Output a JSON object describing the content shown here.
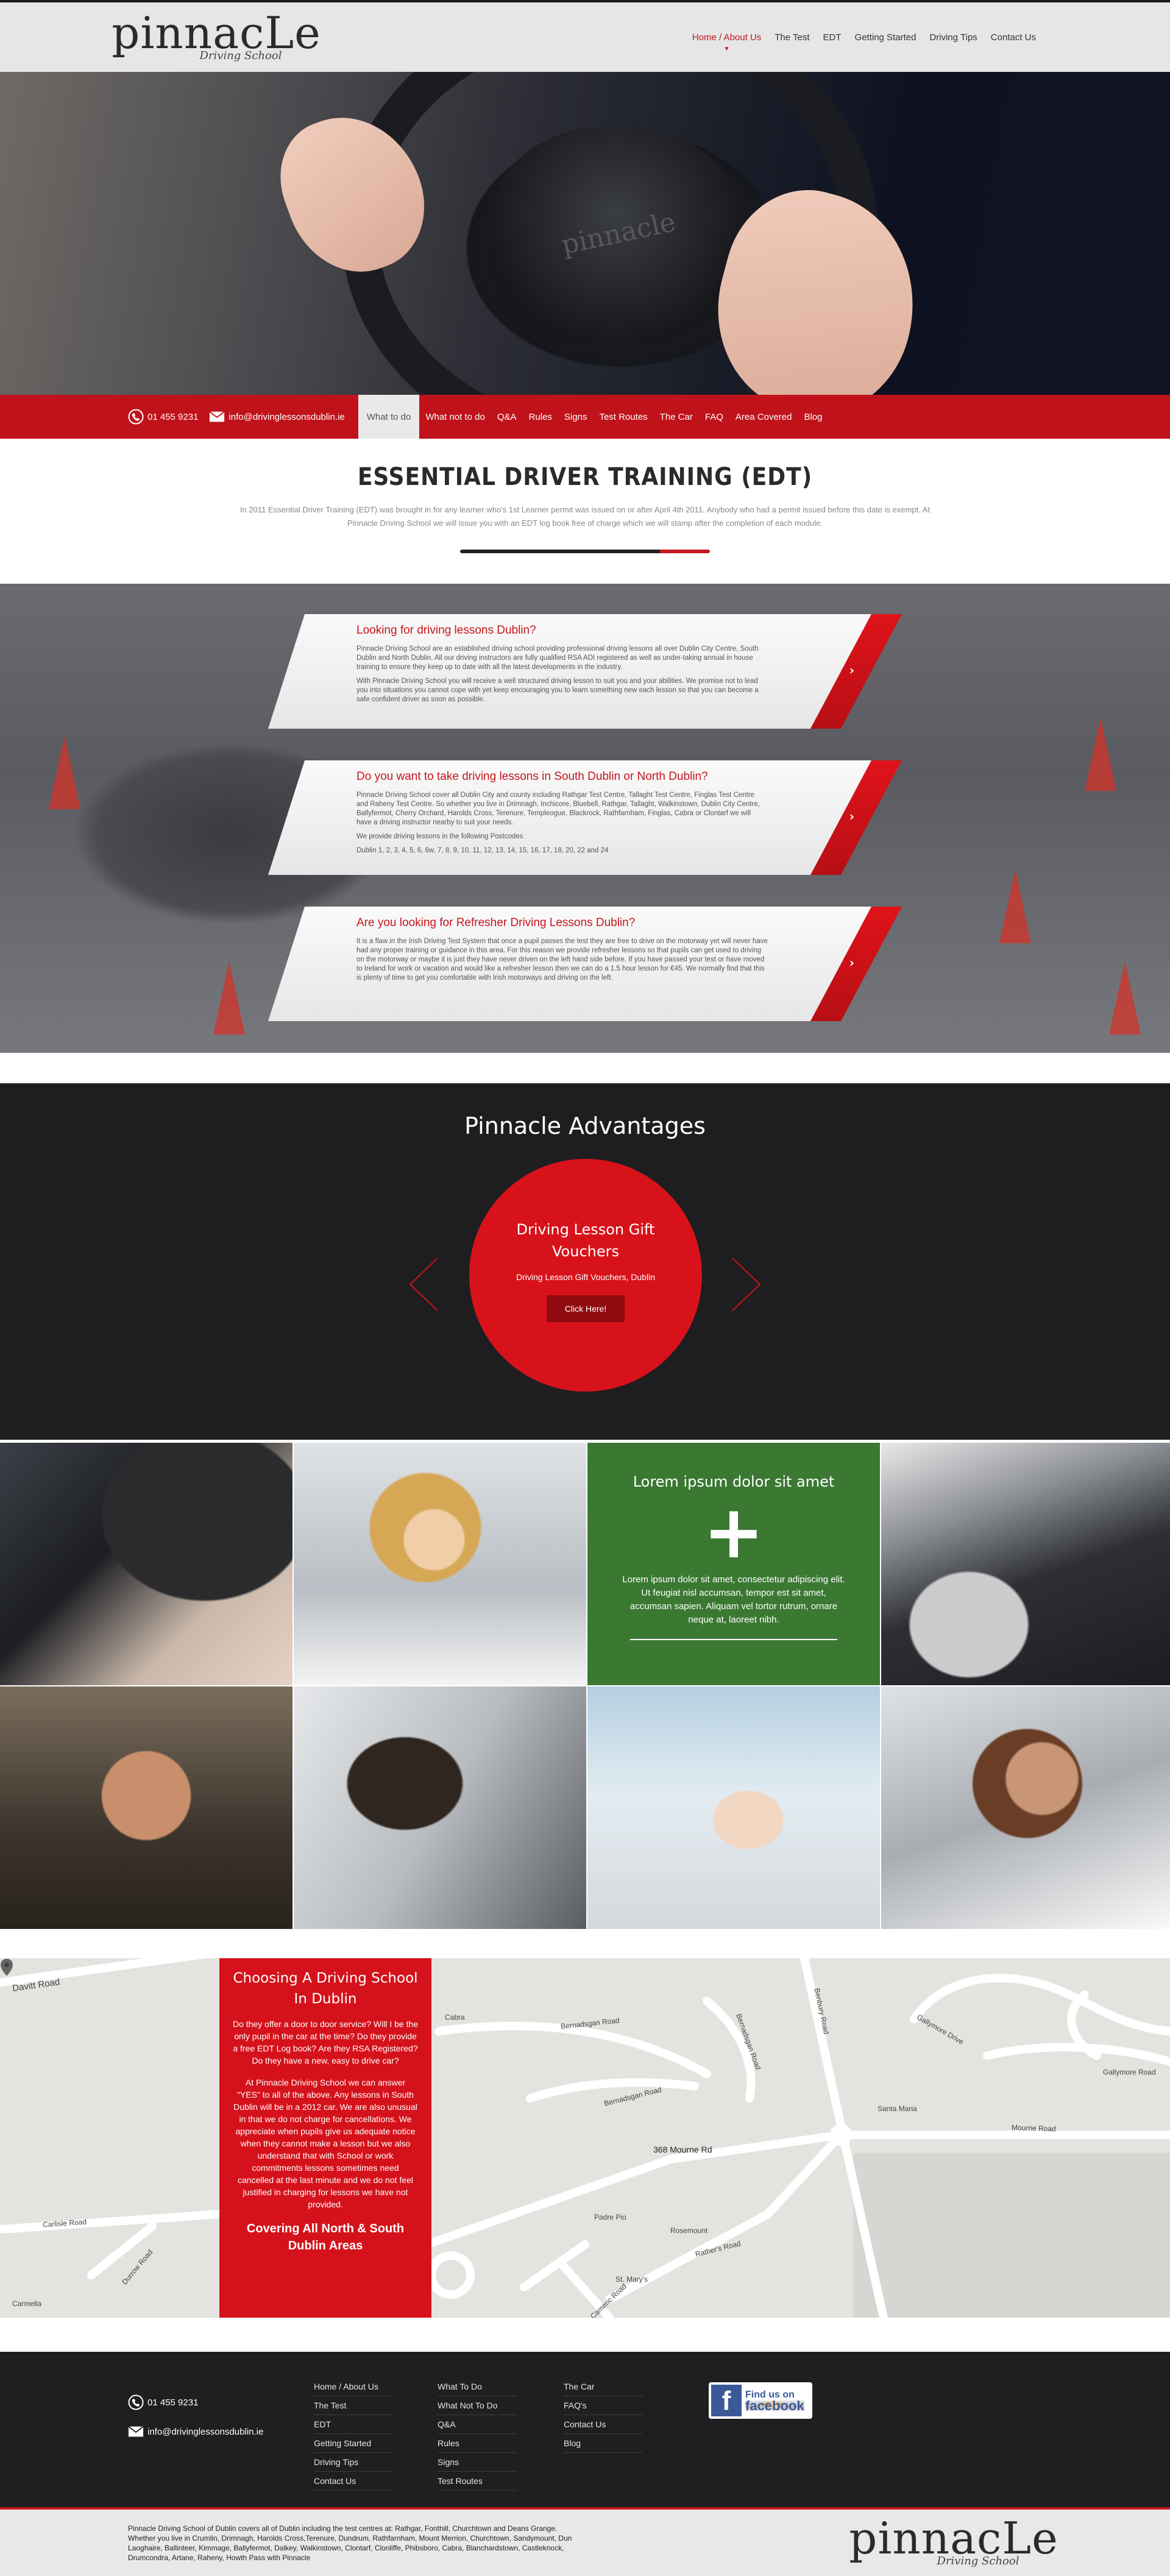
{
  "header": {
    "logo_main": "pinnacLe",
    "logo_sub": "Driving School",
    "nav": [
      "Home / About Us",
      "The Test",
      "EDT",
      "Getting Started",
      "Driving Tips",
      "Contact Us"
    ]
  },
  "hero": {
    "wheel_brand": "pinnacle"
  },
  "contactbar": {
    "phone": "01 455 9231",
    "email": "info@drivinglessonsdublin.ie",
    "subnav": [
      "What to do",
      "What not to do",
      "Q&A",
      "Rules",
      "Signs",
      "Test Routes",
      "The Car",
      "FAQ",
      "Area Covered",
      "Blog"
    ]
  },
  "edt": {
    "title": "Essential Driver Training (EDT)",
    "text": "In 2011 Essential Driver Training (EDT) was brought in for any learner who's 1st Learner permit was issued on or after April 4th 2011. Anybody who had a permit issued before this date is exempt. At Pinnacle Driving School we will issue you with an EDT log book free of charge which we will stamp after the completion of each module."
  },
  "lessons": [
    {
      "title": "Looking for driving lessons Dublin?",
      "p1": "Pinnacle Driving School are an established driving school providing professional driving lessons all over Dublin City Centre, South Dublin and North Dublin. All our driving instructors are fully qualified RSA ADI registered as well as under-taking annual in house training to ensure they keep up to date with all the latest developments in the industry.",
      "p2": "With Pinnacle Driving School you will receive a well structured driving lesson to suit you and your abilities. We promise not to lead you into situations you cannot cope with yet keep encouraging you to learn something new each lesson so that you can become a safe confident driver as soon as possible."
    },
    {
      "title": "Do you want to take driving lessons in South Dublin or North Dublin?",
      "p1": "Pinnacle Driving School cover all Dublin City and county including Rathgar Test Centre, Tallaght Test Centre, Finglas Test Centre and Raheny Test Centre. So whether you live in Drimnagh, Inchicore, Bluebell, Rathgar, Tallaght, Walkinstown, Dublin City Centre, Ballyfermot, Cherry Orchard, Harolds Cross, Terenure, Templeogue, Blackrock, Rathfarnham, Finglas, Cabra or Clontarf we will have a driving instructor nearby to suit your needs.",
      "p2": "We provide driving lessons in the following Postcodes",
      "p3": "Dublin 1, 2, 3, 4, 5, 6, 6w, 7, 8, 9, 10, 11, 12, 13, 14, 15, 16, 17, 18, 20, 22 and 24"
    },
    {
      "title": "Are you looking for Refresher Driving Lessons Dublin?",
      "p1": "It is a flaw in the Irish Driving Test System that once a pupil passes the test they are free to drive on the motorway yet will never have had any proper training or guidance in this area. For this reason we provide refresher lessons so that pupils can get used to driving on the motorway or maybe it is just they have never driven on the left hand side before. If you have passed your test or have moved to Ireland for work or vacation and would like a refresher lesson then we can do a 1.5 hour lesson for €45. We normally find that this is plenty of time to get you comfortable with Irish motorways and driving on the left."
    }
  ],
  "advantages": {
    "title": "Pinnacle Advantages",
    "slide_title": "Driving Lesson Gift Vouchers",
    "slide_text": "Driving Lesson Gift Vouchers, Dublin",
    "button": "Click Here!"
  },
  "gallery": {
    "overlay_title": "Lorem ipsum dolor sit amet",
    "overlay_text": "Lorem ipsum dolor sit amet, consectetur adipiscing elit. Ut feugiat nisl accumsan, tempor est sit amet, accumsan sapien. Aliquam vel tortor rutrum, ornare neque at, laoreet nibh."
  },
  "choosing": {
    "title": "Choosing A Driving School In Dublin",
    "questions": "Do they offer a door to door service? Will I be the only pupil in the car at the time? Do they provide a free EDT Log book? Are they RSA Registered? Do they have a new, easy to drive car?",
    "answer": "At Pinnacle Driving School we can answer \"YES\" to all of the above. Any lessons in South Dublin will be in a 2012 car. We are also unusual in that we do not charge for cancellations. We appreciate when pupils give us adequate notice when they cannot make a lesson but we also understand that with School or work commitments lessons sometimes need cancelled at the last minute and we do not feel justified in charging for lessons we have not provided.",
    "footer": "Covering All North & South Dublin Areas"
  },
  "map": {
    "labels": [
      "Davitt Road",
      "Cabra",
      "Bernadsgan Road",
      "Bernadsgan Road",
      "Bernadsgan Road",
      "Benbury Road",
      "Gallymore Drive",
      "Gallymore Road",
      "Santa Maria",
      "Mourne Road",
      "368 Mourne Rd",
      "Padre Pio",
      "Rosemount",
      "Rather's Road",
      "St. Mary's",
      "Cameric Road",
      "Durrow Road",
      "Carlisle Road",
      "Carmella"
    ]
  },
  "footer": {
    "phone": "01 455 9231",
    "email": "info@drivinglessonsdublin.ie",
    "col1": [
      "Home / About Us",
      "The Test",
      "EDT",
      "Getting Started",
      "Driving Tips",
      "Contact Us"
    ],
    "col2": [
      "What To Do",
      "What Not To Do",
      "Q&A",
      "Rules",
      "Signs",
      "Test Routes"
    ],
    "col3": [
      "The Car",
      "FAQ's",
      "Contact Us",
      "Blog"
    ],
    "fb_line1": "Find us on",
    "fb_line2": "facebook",
    "bottom_text": "Pinnacle Driving School of Dublin covers all of Dublin including the test centres at: Rathgar, Fonthill, Churchtown and Deans Grange. Whether you live in Crumlin, Drimnagh, Harolds Cross,Terenure, Dundrum, Rathfarnham, Mount Merrion, Churchtown, Sandymount, Dun Laoghaire, Ballinteer, Kimmage, Ballyfermot, Dalkey, Walkinstown, Clontarf, Clonliffe, Phibsboro, Cabra, Blanchardstown, Castleknock, Drumcondra, Artane, Raheny, Howth Pass with Pinnacle"
  },
  "colors": {
    "brand_red": "#c6161c",
    "dark": "#1e1e20",
    "green": "#3a7d3a"
  }
}
